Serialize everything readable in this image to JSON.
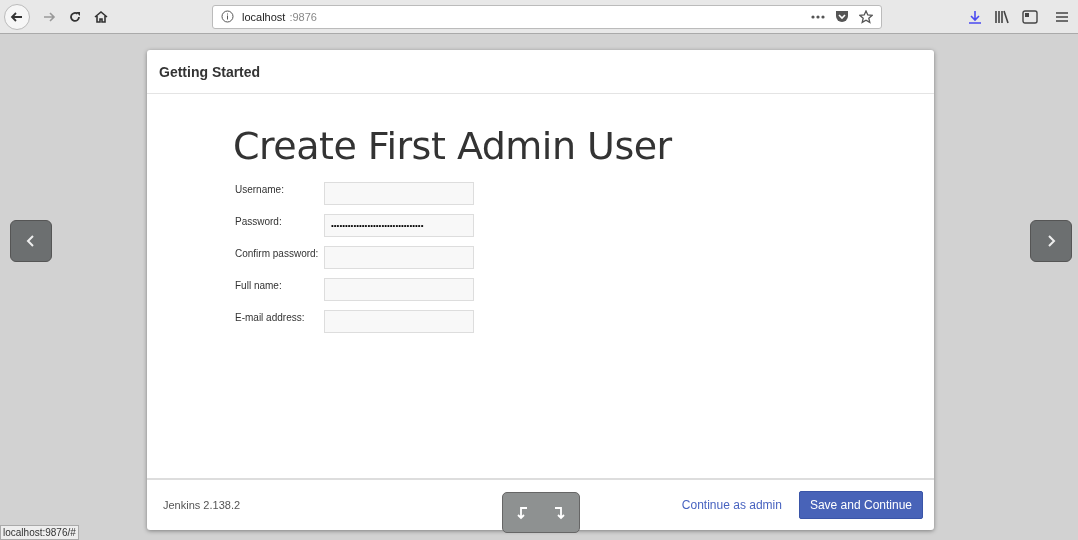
{
  "browser": {
    "url_host": "localhost",
    "url_port": ":9876"
  },
  "dialog": {
    "header": "Getting Started",
    "title": "Create First Admin User",
    "fields": [
      {
        "label": "Username:"
      },
      {
        "label": "Password:",
        "value": "•••••••••••••••••••••••••••••••••"
      },
      {
        "label": "Confirm password:"
      },
      {
        "label": "Full name:"
      },
      {
        "label": "E-mail address:"
      }
    ],
    "version": "Jenkins 2.138.2",
    "link": "Continue as admin",
    "primary_button": "Save and Continue"
  },
  "status_bar": "localhost:9876/#"
}
